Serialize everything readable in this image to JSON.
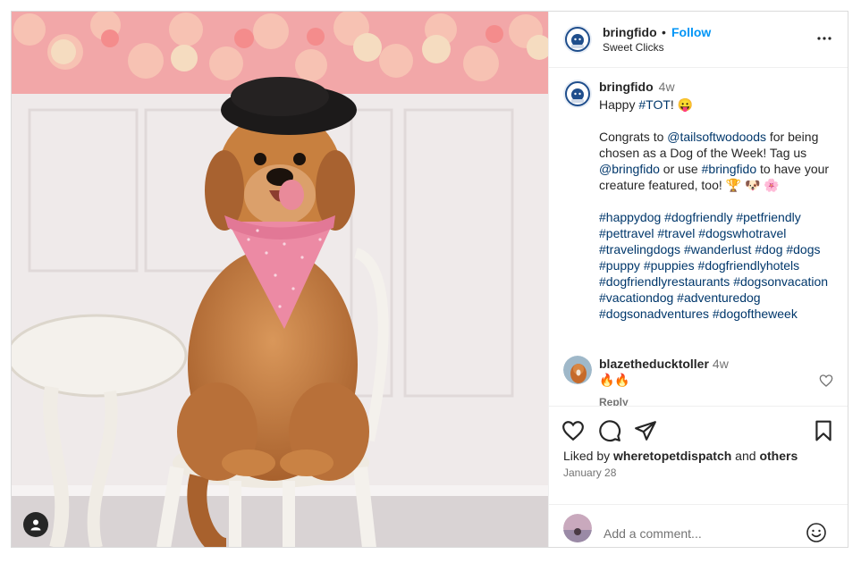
{
  "post": {
    "author": "bringfido",
    "separator": "•",
    "follow_label": "Follow",
    "subtitle": "Sweet Clicks",
    "more_icon": "more-horizontal-icon",
    "tag_icon": "user-tag-icon"
  },
  "caption": {
    "username": "bringfido",
    "time": "4w",
    "line1_prefix": "Happy ",
    "line1_tag": "#TOT",
    "line1_suffix": "! 😛",
    "p2_a": "Congrats to ",
    "p2_mention": "@tailsoftwodoods",
    "p2_b": " for being chosen as a Dog of the Week! Tag us ",
    "p2_mention2": "@bringfido",
    "p2_c": " or use ",
    "p2_tag": "#bringfido",
    "p2_d": " to have your creature featured, too! 🏆 🐶 🌸",
    "hashtags": "#happydog #dogfriendly #petfriendly #pettravel #travel #dogswhotravel #travelingdogs #wanderlust #dog #dogs #puppy #puppies #dogfriendlyhotels #dogfriendlyrestaurants #dogsonvacation #vacationdog #adventuredog #dogsonadventures #dogoftheweek"
  },
  "comment": {
    "username": "blazetheducktoller",
    "time": "4w",
    "text": "🔥🔥",
    "reply_label": "Reply"
  },
  "actions": {
    "liked_prefix": "Liked by ",
    "liked_user": "wheretopetdispatch",
    "liked_and": " and ",
    "liked_others": "others",
    "date": "January 28"
  },
  "add_comment": {
    "placeholder": "Add a comment..."
  },
  "colors": {
    "link": "#00376b",
    "follow": "#0095f6",
    "muted": "#737373"
  }
}
